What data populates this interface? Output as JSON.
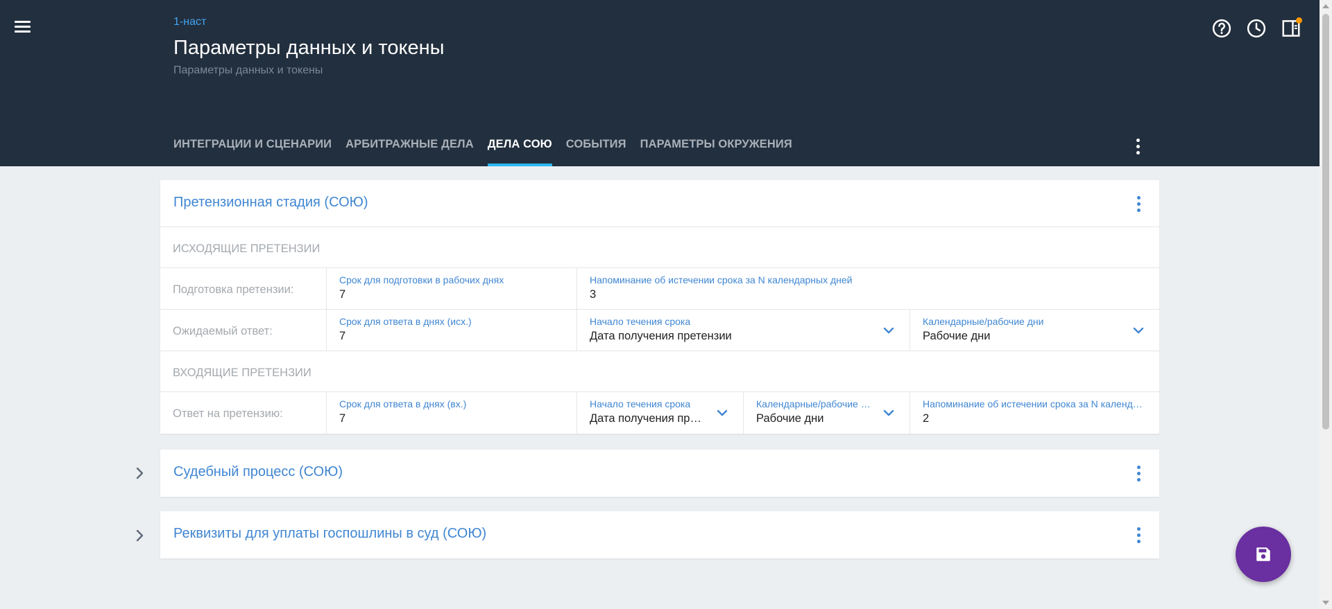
{
  "header": {
    "breadcrumb": "1-наст",
    "title": "Параметры данных и токены",
    "subtitle": "Параметры данных и токены",
    "icons": [
      "menu-icon",
      "help-icon",
      "history-icon",
      "panel-icon"
    ]
  },
  "tabs": [
    {
      "label": "ИНТЕГРАЦИИ И СЦЕНАРИИ",
      "active": false
    },
    {
      "label": "АРБИТРАЖНЫЕ ДЕЛА",
      "active": false
    },
    {
      "label": "ДЕЛА СОЮ",
      "active": true
    },
    {
      "label": "СОБЫТИЯ",
      "active": false
    },
    {
      "label": "ПАРАМЕТРЫ ОКРУЖЕНИЯ",
      "active": false
    }
  ],
  "claims_card": {
    "title": "Претензионная стадия (СОЮ)",
    "outgoing": {
      "section_label": "ИСХОДЯЩИЕ ПРЕТЕНЗИИ",
      "preparation": {
        "label": "Подготовка претензии:",
        "prep_days": {
          "label": "Срок для подготовки в рабочих днях",
          "value": "7"
        },
        "reminder": {
          "label": "Напоминание об истечении срока за N календарных дней",
          "value": "3"
        }
      },
      "expected": {
        "label": "Ожидаемый ответ:",
        "answer_days": {
          "label": "Срок для ответа в днях (исх.)",
          "value": "7"
        },
        "start": {
          "label": "Начало течения срока",
          "value": "Дата получения претензии"
        },
        "day_type": {
          "label": "Календарные/рабочие дни",
          "value": "Рабочие дни"
        }
      }
    },
    "incoming": {
      "section_label": "ВХОДЯЩИЕ ПРЕТЕНЗИИ",
      "answer": {
        "label": "Ответ на претензию:",
        "answer_days": {
          "label": "Срок для ответа в днях (вх.)",
          "value": "7"
        },
        "start": {
          "label": "Начало течения срока",
          "value": "Дата получения претензии"
        },
        "day_type": {
          "label": "Календарные/рабочие дни",
          "value": "Рабочие дни"
        },
        "reminder": {
          "label": "Напоминание об истечении срока за N календарных дней",
          "value": "2"
        }
      }
    }
  },
  "court_card": {
    "title": "Судебный процесс (СОЮ)"
  },
  "fee_card": {
    "title": "Реквизиты для уплаты госпошлины в суд (СОЮ)"
  },
  "fab": {
    "icon": "save-icon",
    "color": "#6a2fa0"
  },
  "colors": {
    "header_bg": "#222f3e",
    "accent": "#3f86d2",
    "tab_indicator": "#29b6f6",
    "badge": "#ff9800"
  }
}
